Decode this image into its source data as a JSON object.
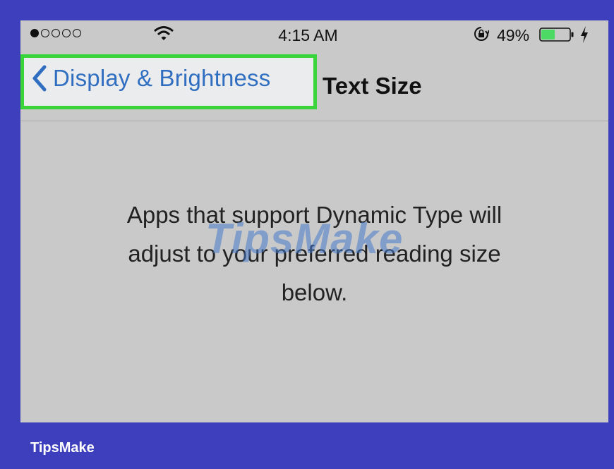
{
  "status_bar": {
    "time": "4:15 AM",
    "battery_percent": "49%",
    "signal_bars_filled": 1,
    "signal_bars_total": 5,
    "battery_level": 0.49,
    "icons": [
      "signal-dots-icon",
      "wifi-icon",
      "rotation-lock-icon",
      "battery-icon",
      "charging-bolt-icon"
    ]
  },
  "nav": {
    "back_label": "Display & Brightness",
    "title": "Text Size"
  },
  "body": {
    "description_line1": "Apps that support Dynamic Type will",
    "description_line2": "adjust to your preferred reading size",
    "description_line3": "below."
  },
  "watermark": "TipsMake",
  "footer": {
    "brand": "TipsMake"
  },
  "colors": {
    "frame": "#3d3fbc",
    "screen": "#c9c9c9",
    "highlight_border": "#39d53a",
    "ios_blue": "#2f6ec0",
    "battery_green": "#4cd964"
  }
}
